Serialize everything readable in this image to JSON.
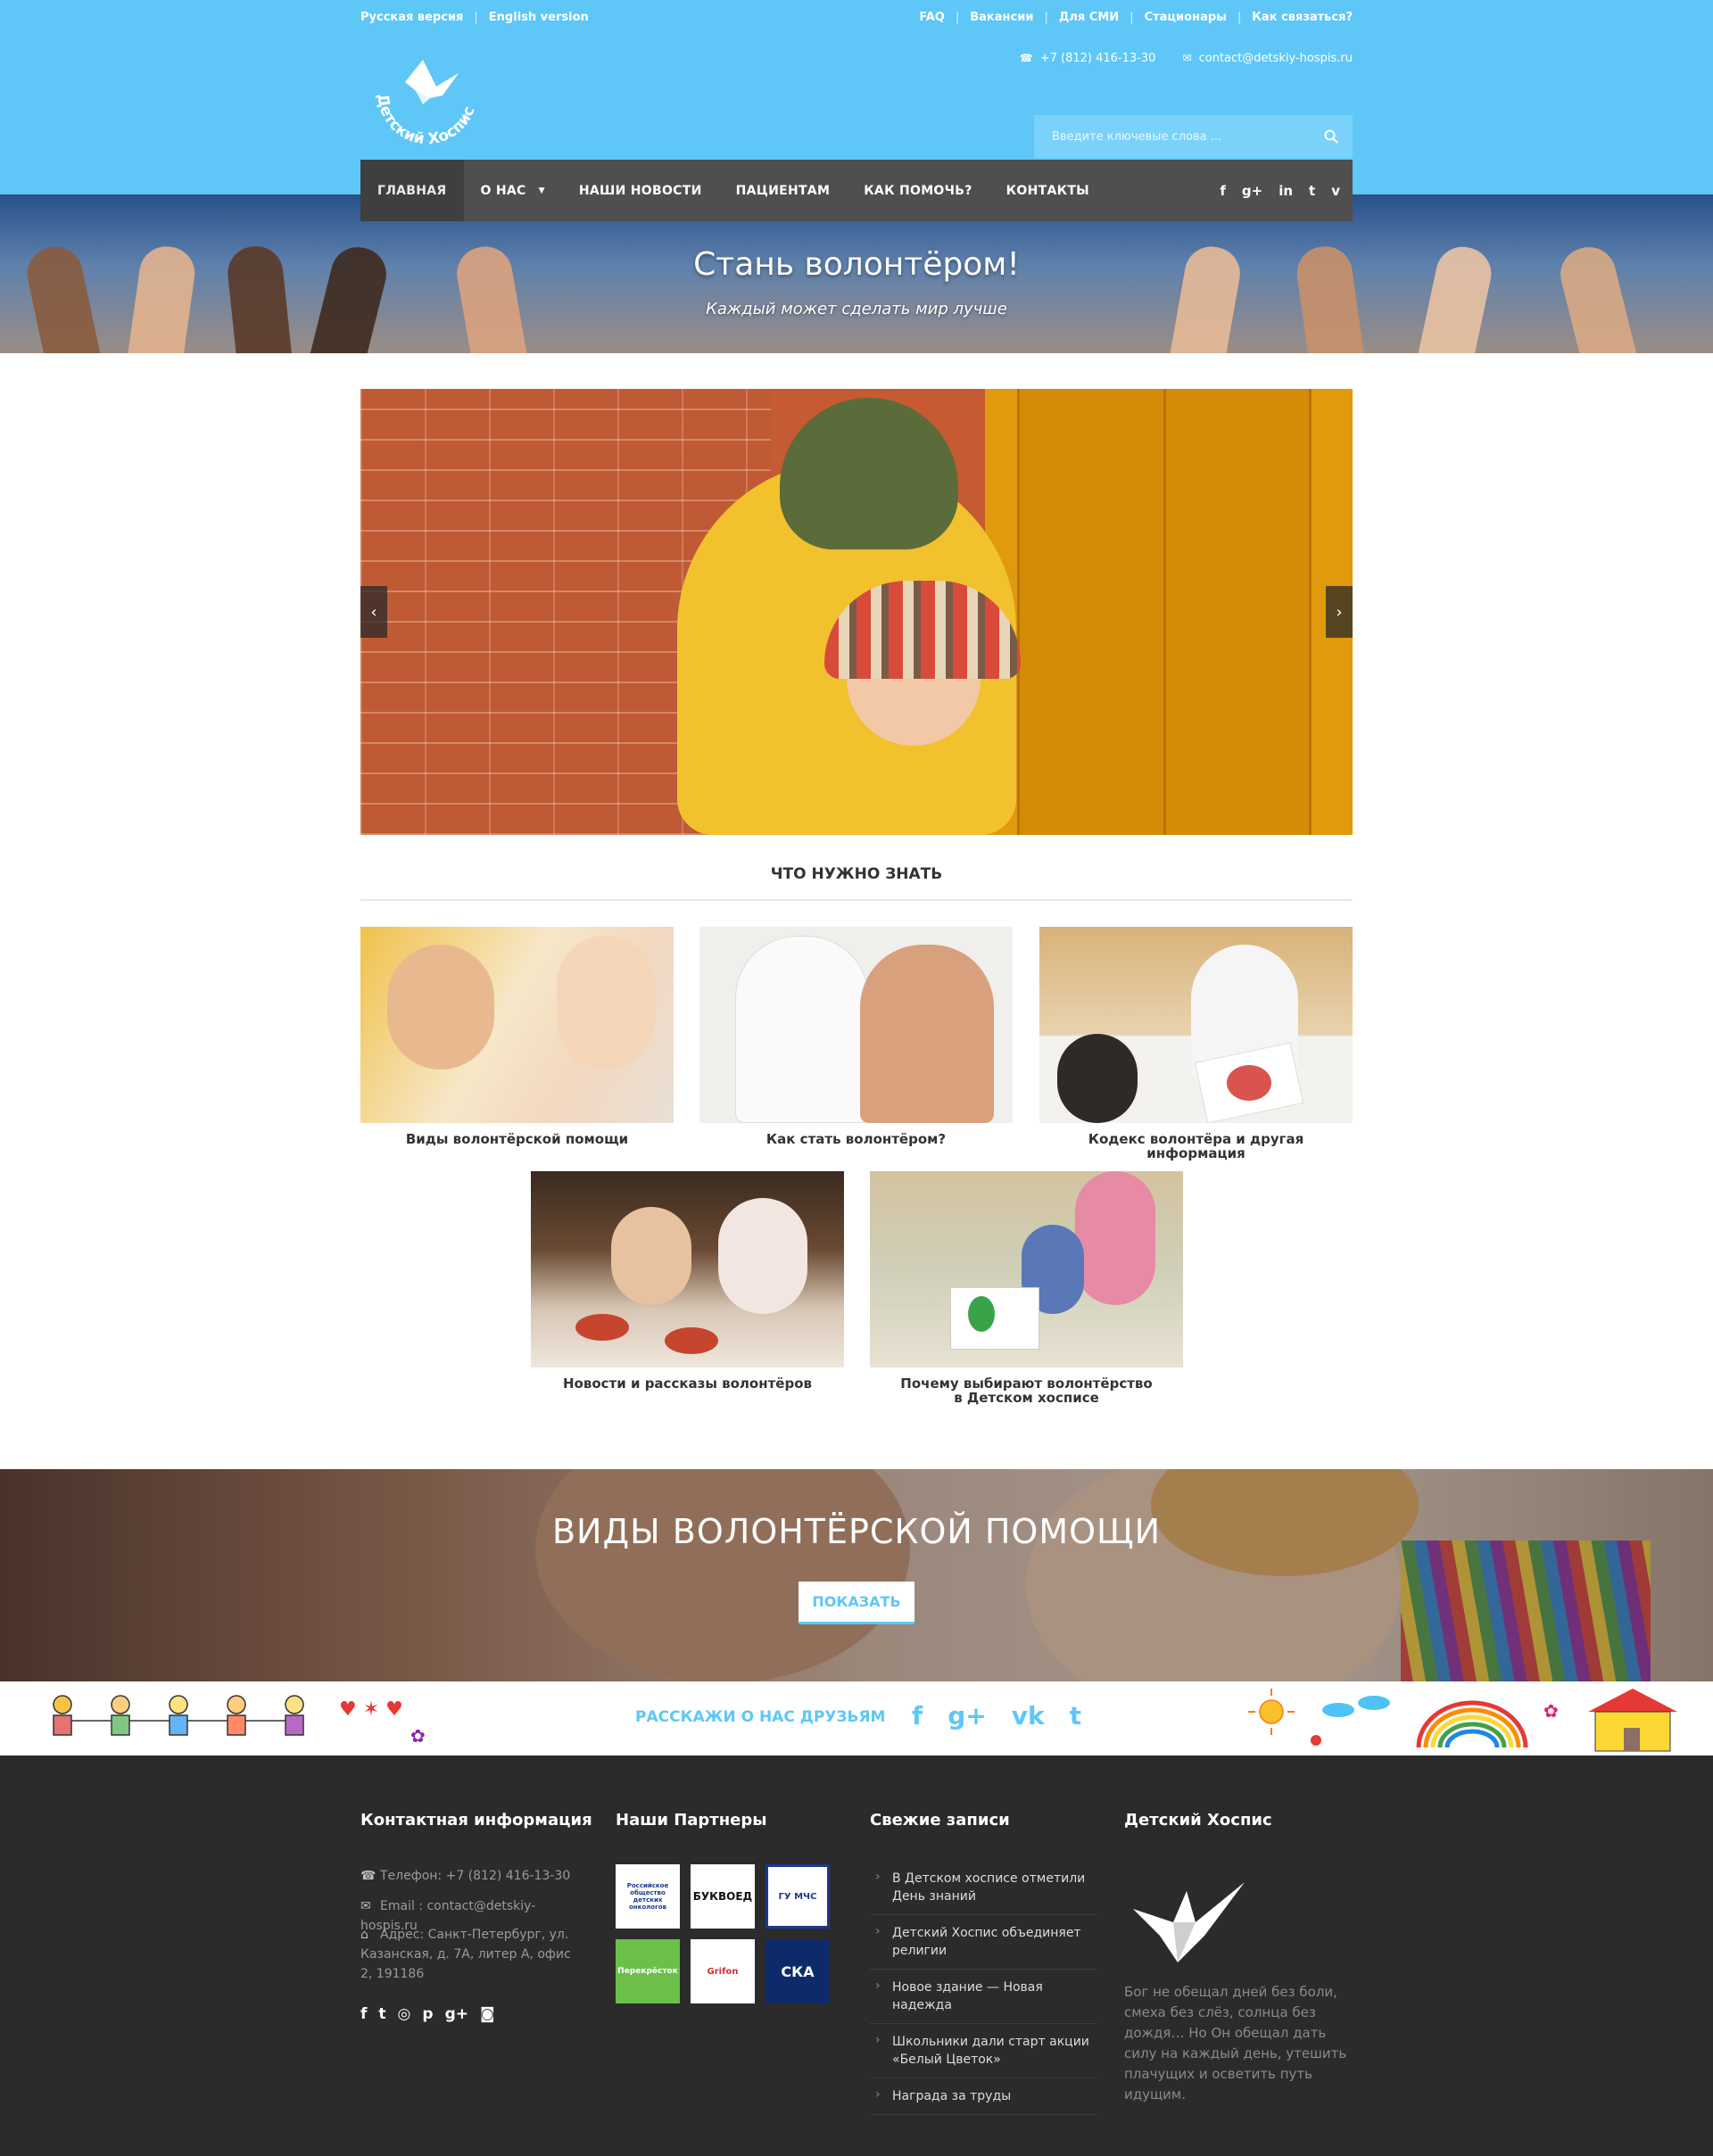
{
  "header": {
    "lang_ru": "Русская версия",
    "lang_en": "English version",
    "top_links": [
      "FAQ",
      "Вакансии",
      "Для СМИ",
      "Стационары",
      "Как связаться?"
    ],
    "phone": "+7 (812) 416-13-30",
    "email": "contact@detskiy-hospis.ru",
    "logo_text": "Детский Хоспис",
    "search_placeholder": "Введите ключевые слова ..."
  },
  "nav": {
    "items": [
      "ГЛАВНАЯ",
      "О НАС",
      "НАШИ НОВОСТИ",
      "ПАЦИЕНТАМ",
      "КАК ПОМОЧЬ?",
      "КОНТАКТЫ"
    ],
    "social": [
      "facebook-icon",
      "google-plus-icon",
      "linkedin-icon",
      "twitter-icon",
      "vimeo-icon"
    ]
  },
  "hero": {
    "title": "Стань волонтёром!",
    "subtitle": "Каждый может сделать мир лучше"
  },
  "know": {
    "title": "ЧТО НУЖНО ЗНАТЬ",
    "cards": [
      "Виды волонтёрской помощи",
      "Как стать волонтёром?",
      "Кодекс волонтёра и другая информация",
      "Новости и рассказы волонтёров",
      "Почему выбирают волонтёрство\nв Детском хосписе"
    ]
  },
  "banner": {
    "title": "ВИДЫ ВОЛОНТЁРСКОЙ ПОМОЩИ",
    "button": "ПОКАЗАТЬ"
  },
  "share": {
    "label": "РАССКАЖИ О НАС ДРУЗЬЯМ",
    "social": [
      "facebook-icon",
      "google-plus-icon",
      "vk-icon",
      "twitter-icon"
    ]
  },
  "footer": {
    "contact_title": "Контактная информация",
    "phone": "Телефон: +7 (812) 416-13-30",
    "email": "Email : contact@detskiy-hospis.ru",
    "address": "Адрес: Санкт-Петербург, ул. Казанская, д. 7А, литер А, офис 2, 191186",
    "partners_title": "Наши Партнеры",
    "partners": [
      {
        "name": "Российское общество детских онкологов",
        "bg": "#ffffff",
        "fg": "#1b3a8c"
      },
      {
        "name": "БУКВОЕД",
        "bg": "#ffffff",
        "fg": "#111111"
      },
      {
        "name": "ГУ МЧС",
        "bg": "#ffffff",
        "fg": "#1b3a8c"
      },
      {
        "name": "Перекрёсток",
        "bg": "#6cc04a",
        "fg": "#ffffff"
      },
      {
        "name": "Grifon",
        "bg": "#ffffff",
        "fg": "#d32f2f"
      },
      {
        "name": "СКА",
        "bg": "#0d2a6b",
        "fg": "#ffffff"
      }
    ],
    "posts_title": "Свежие записи",
    "posts": [
      "В Детском хосписе отметили День знаний",
      "Детский Хоспис объединяет религии",
      "Новое здание — Новая надежда",
      "Школьники дали старт акции «Белый Цветок»",
      "Награда за труды"
    ],
    "about_title": "Детский Хоспис",
    "quote": "Бог не обещал дней без боли, смеха без слёз, солнца без дождя… Но Он обещал дать силу на каждый день, утешить плачущих и осветить путь идущим."
  },
  "colors": {
    "brand_blue": "#5ec7f7",
    "nav_bg": "#4f4f4f",
    "footer_bg": "#2b2b2b"
  }
}
